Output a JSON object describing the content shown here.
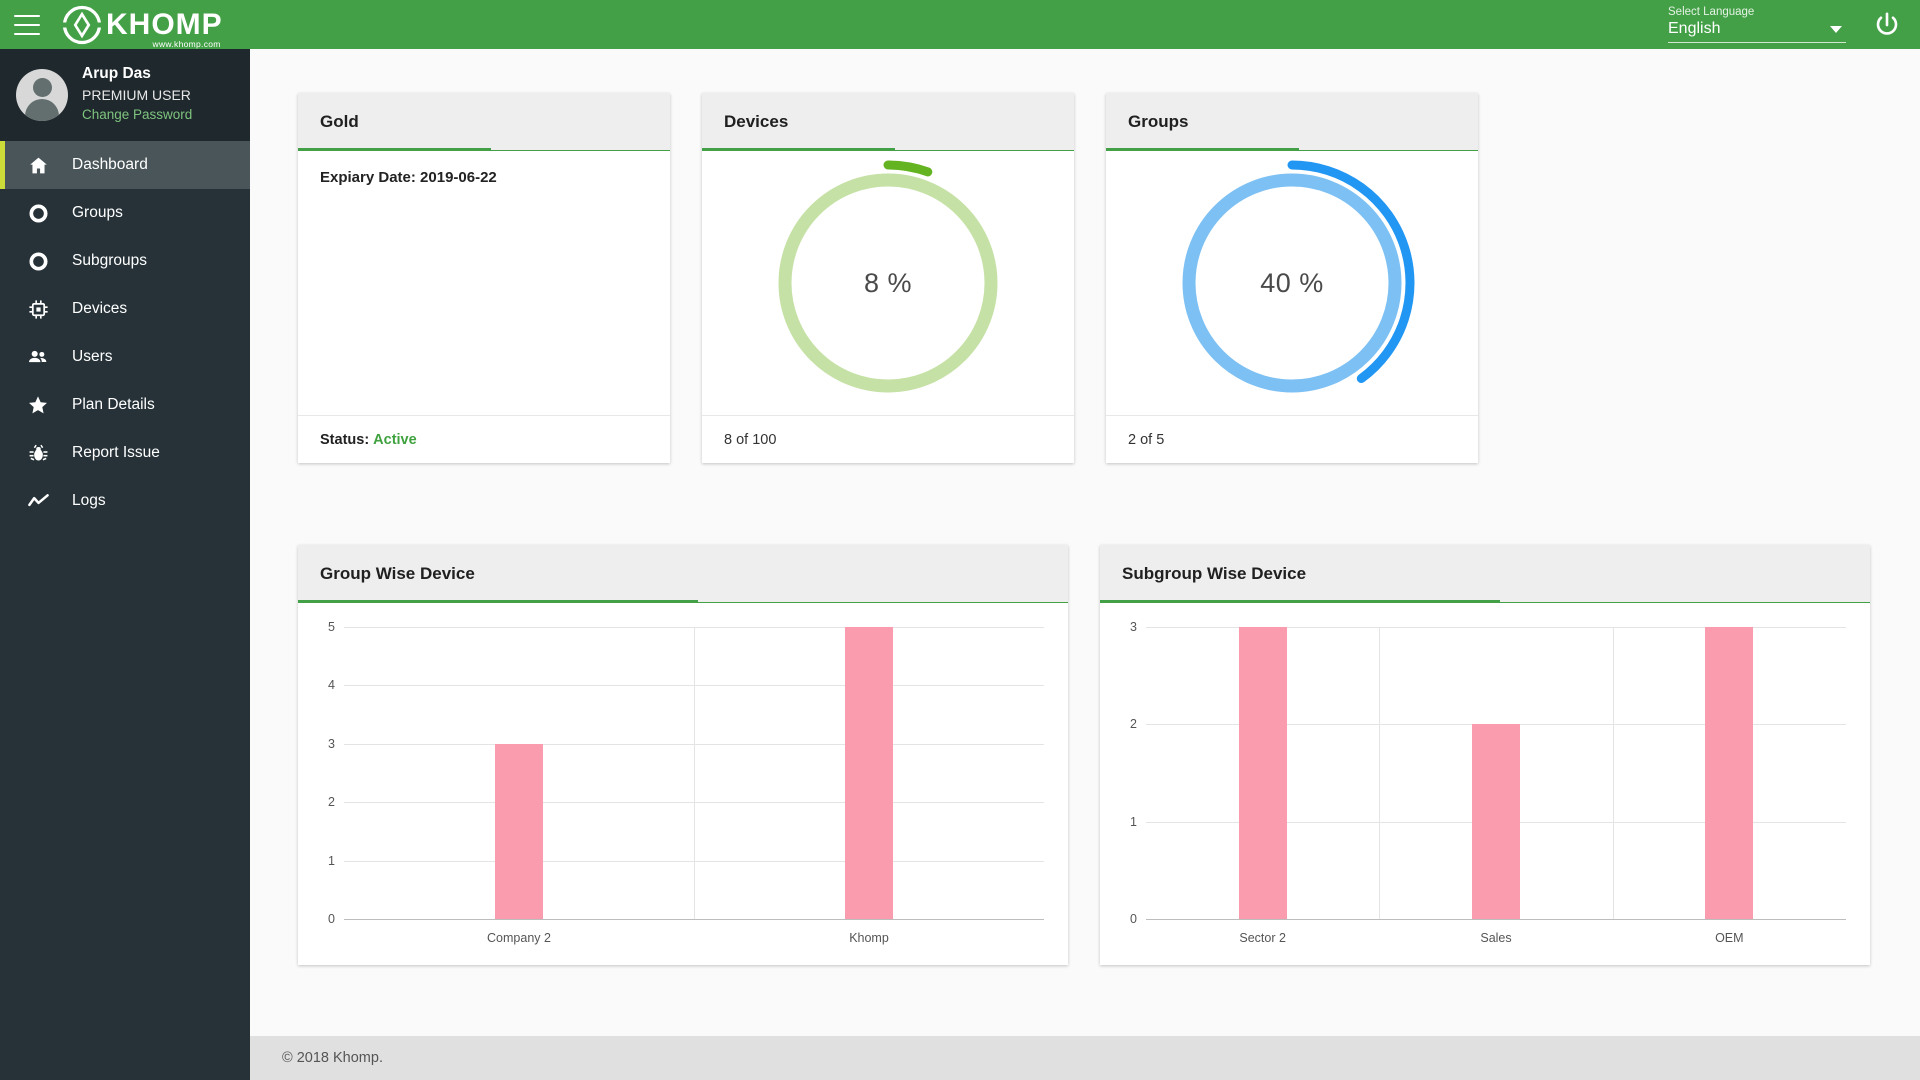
{
  "topbar": {
    "menu_icon": "hamburger-menu-icon",
    "brand_name": "KHOMP",
    "brand_url": "www.khomp.com",
    "language_label": "Select Language",
    "language_value": "English",
    "language_options": [
      "English"
    ],
    "power_icon": "power-icon",
    "background": "#43a047"
  },
  "sidebar": {
    "profile": {
      "name": "Arup Das",
      "role": "PREMIUM USER",
      "change_password": "Change Password"
    },
    "items": [
      {
        "label": "Dashboard",
        "icon": "home-icon",
        "active": true
      },
      {
        "label": "Groups",
        "icon": "circle-icon",
        "active": false
      },
      {
        "label": "Subgroups",
        "icon": "circle-icon",
        "active": false
      },
      {
        "label": "Devices",
        "icon": "chip-icon",
        "active": false
      },
      {
        "label": "Users",
        "icon": "people-icon",
        "active": false
      },
      {
        "label": "Plan Details",
        "icon": "star-icon",
        "active": false
      },
      {
        "label": "Report Issue",
        "icon": "bug-icon",
        "active": false
      },
      {
        "label": "Logs",
        "icon": "trending-up-icon",
        "active": false
      }
    ],
    "active_accent": "#cddc39",
    "background": "#263238"
  },
  "cards": {
    "gold": {
      "title": "Gold",
      "expiry_text": "Expiary Date: 2019-06-22",
      "status_label": "Status:",
      "status_value": "Active",
      "status_color": "#3fa23f"
    },
    "devices": {
      "title": "Devices",
      "center_text": "8 %",
      "footer_text": "8 of 100"
    },
    "groups": {
      "title": "Groups",
      "center_text": "40 %",
      "footer_text": "2 of 5"
    }
  },
  "footer": {
    "copyright": "© 2018 Khomp."
  },
  "chart_data": [
    {
      "type": "gauge",
      "title": "Devices",
      "value": 8,
      "max": 100,
      "unit": "%",
      "center_label": "8 %",
      "footer_label": "8 of 100",
      "track_color": "#c5e1a5",
      "value_color": "#64b320"
    },
    {
      "type": "gauge",
      "title": "Groups",
      "value": 40,
      "max": 100,
      "unit": "%",
      "center_label": "40 %",
      "footer_label": "2 of 5",
      "track_color": "#7cc0f4",
      "value_color": "#2196f3"
    },
    {
      "type": "bar",
      "title": "Group Wise Device",
      "categories": [
        "Company 2",
        "Khomp"
      ],
      "values": [
        3,
        5
      ],
      "xlabel": "",
      "ylabel": "",
      "ylim": [
        0,
        5
      ],
      "yticks": [
        0,
        1,
        2,
        3,
        4,
        5
      ],
      "grid": true,
      "legend": "none",
      "bar_color": "#fb9cae"
    },
    {
      "type": "bar",
      "title": "Subgroup Wise Device",
      "categories": [
        "Sector 2",
        "Sales",
        "OEM"
      ],
      "values": [
        3,
        2,
        3
      ],
      "xlabel": "",
      "ylabel": "",
      "ylim": [
        0,
        3
      ],
      "yticks": [
        0,
        1,
        2,
        3
      ],
      "grid": true,
      "legend": "none",
      "bar_color": "#fb9cae"
    }
  ]
}
